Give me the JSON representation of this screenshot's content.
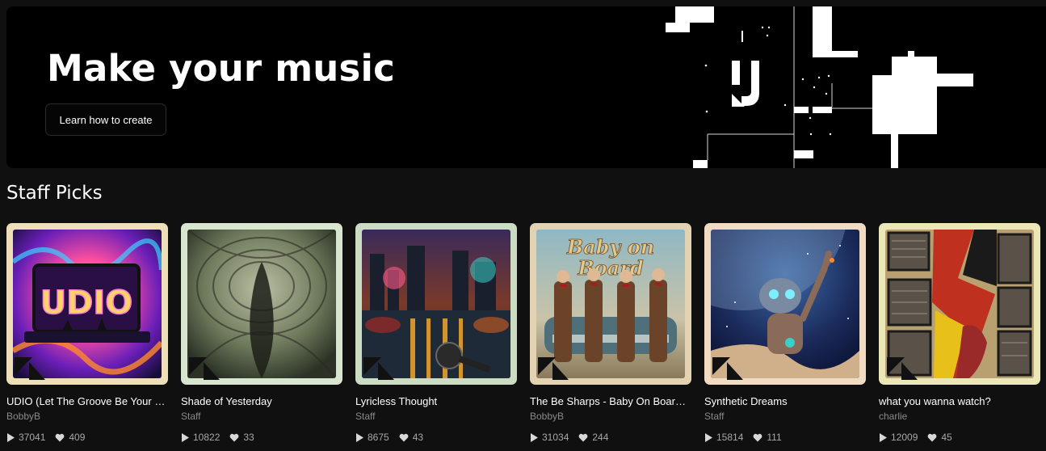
{
  "hero": {
    "title": "Make your music",
    "cta_label": "Learn how to create"
  },
  "section": {
    "title": "Staff Picks"
  },
  "cards": [
    {
      "title": "UDIO (Let The Groove Be Your Guide)",
      "artist": "BobbyB",
      "plays": "37041",
      "likes": "409",
      "frame_color": "#efdfb9",
      "art": "udio-neon-laptop"
    },
    {
      "title": "Shade of Yesterday",
      "artist": "Staff",
      "plays": "10822",
      "likes": "33",
      "frame_color": "#d9e6cf",
      "art": "shadowy-figure-tunnel"
    },
    {
      "title": "Lyricless Thought",
      "artist": "Staff",
      "plays": "8675",
      "likes": "43",
      "frame_color": "#cbdcc2",
      "art": "city-street-microphone"
    },
    {
      "title": "The Be Sharps - Baby On Board, Baby On Board",
      "artist": "BobbyB",
      "plays": "31034",
      "likes": "244",
      "frame_color": "#e3d3b3",
      "art": "baby-on-board-quartet"
    },
    {
      "title": "Synthetic Dreams",
      "artist": "Staff",
      "plays": "15814",
      "likes": "111",
      "frame_color": "#f1dcc3",
      "art": "robot-moon"
    },
    {
      "title": "what you wanna watch?",
      "artist": "charlie",
      "plays": "12009",
      "likes": "45",
      "frame_color": "#ece7b7",
      "art": "tv-collage"
    }
  ]
}
